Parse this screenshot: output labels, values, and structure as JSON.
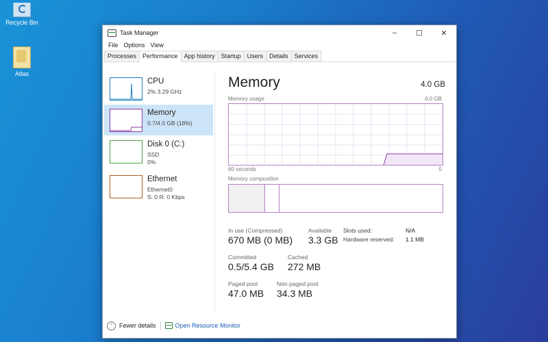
{
  "desktop": {
    "icons": [
      {
        "label": "Recycle Bin",
        "icon": "recycle-bin-icon"
      },
      {
        "label": "Atlas",
        "icon": "folder-icon"
      }
    ]
  },
  "window": {
    "title": "Task Manager",
    "controls": {
      "minimize": "–",
      "maximize": "☐",
      "close": "✕"
    }
  },
  "menu": [
    "File",
    "Options",
    "View"
  ],
  "tabs": [
    "Processes",
    "Performance",
    "App history",
    "Startup",
    "Users",
    "Details",
    "Services"
  ],
  "active_tab": "Performance",
  "sidebar": [
    {
      "title": "CPU",
      "lines": [
        "2% 3.29 GHz"
      ],
      "color": "#1a7dc4"
    },
    {
      "title": "Memory",
      "lines": [
        "0.7/4.0 GB (18%)"
      ],
      "color": "#8e3aa8",
      "selected": true
    },
    {
      "title": "Disk 0 (C:)",
      "lines": [
        "SSD",
        "0%"
      ],
      "color": "#4aa040"
    },
    {
      "title": "Ethernet",
      "lines": [
        "Ethernet0",
        "S: 0 R: 0 Kbps"
      ],
      "color": "#a75f2a"
    }
  ],
  "main": {
    "title": "Memory",
    "total": "4.0 GB",
    "usage_label": "Memory usage",
    "usage_max": "4.0 GB",
    "time_label": "60 seconds",
    "time_end": "0",
    "composition_label": "Memory composition",
    "stats": {
      "in_use_label": "In use (Compressed)",
      "in_use": "670 MB (0 MB)",
      "available_label": "Available",
      "available": "3.3 GB",
      "committed_label": "Committed",
      "committed": "0.5/5.4 GB",
      "cached_label": "Cached",
      "cached": "272 MB",
      "paged_label": "Paged pool",
      "paged": "47.0 MB",
      "nonpaged_label": "Non-paged pool",
      "nonpaged": "34.3 MB",
      "slots_label": "Slots used:",
      "slots": "N/A",
      "hw_label": "Hardware reserved:",
      "hw": "1.1 MB"
    }
  },
  "footer": {
    "fewer_details": "Fewer details",
    "resource_monitor": "Open Resource Monitor"
  },
  "colors": {
    "memory_accent": "#b47fc8",
    "selected_bg": "#cce4f7",
    "link": "#1a5fb4"
  }
}
